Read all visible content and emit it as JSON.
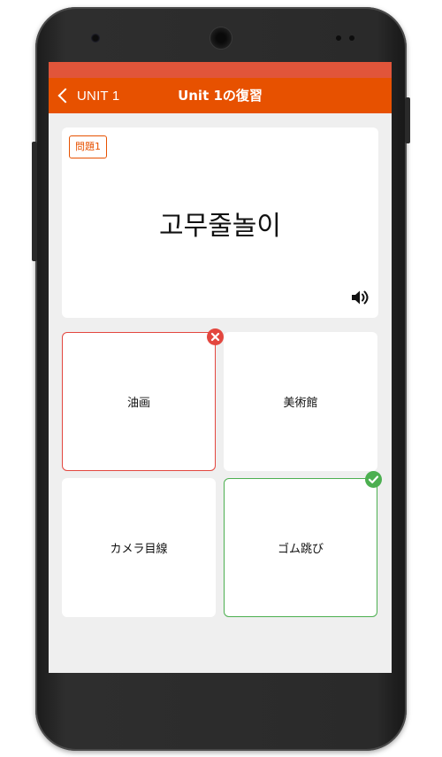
{
  "app_bar": {
    "back_label": "UNIT 1",
    "title": "Unit 1の復習"
  },
  "question": {
    "badge": "問題1",
    "word": "고무줄놀이",
    "audio_icon": "speaker-volume-icon"
  },
  "answers": [
    {
      "label": "油画",
      "state": "wrong",
      "mark_icon": "close-icon"
    },
    {
      "label": "美術館",
      "state": "none"
    },
    {
      "label": "カメラ目線",
      "state": "none"
    },
    {
      "label": "ゴム跳び",
      "state": "correct",
      "mark_icon": "check-icon"
    }
  ],
  "colors": {
    "accent": "#e75100",
    "status_bar": "#e1553a",
    "wrong": "#e3473f",
    "correct": "#4caf50",
    "screen_bg": "#efefef"
  }
}
